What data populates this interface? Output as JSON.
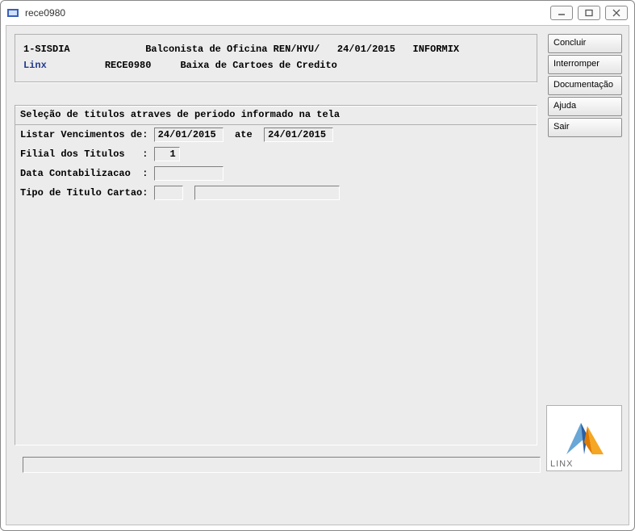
{
  "window": {
    "title": "rece0980"
  },
  "header": {
    "system": "1-SISDIA",
    "role": "Balconista de Oficina REN/HYU/",
    "date": "24/01/2015",
    "db": "INFORMIX",
    "company": "Linx",
    "program": "RECE0980",
    "description": "Baixa de Cartoes de Credito"
  },
  "section_title": "Seleção de titulos atraves de periodo informado na tela",
  "form": {
    "label_date_range": "Listar Vencimentos de:",
    "date_from": "24/01/2015",
    "label_ate": "ate",
    "date_to": "24/01/2015",
    "label_filial": "Filial dos Titulos   :",
    "filial": "1",
    "label_data_contab": "Data Contabilizacao  :",
    "data_contab": "",
    "label_tipo": "Tipo de Titulo Cartao:",
    "tipo_code": "",
    "tipo_desc": ""
  },
  "buttons": {
    "concluir": "Concluir",
    "interromper": "Interromper",
    "documentacao": "Documentação",
    "ajuda": "Ajuda",
    "sair": "Sair"
  },
  "logo": {
    "text": "LINX"
  },
  "status": ""
}
